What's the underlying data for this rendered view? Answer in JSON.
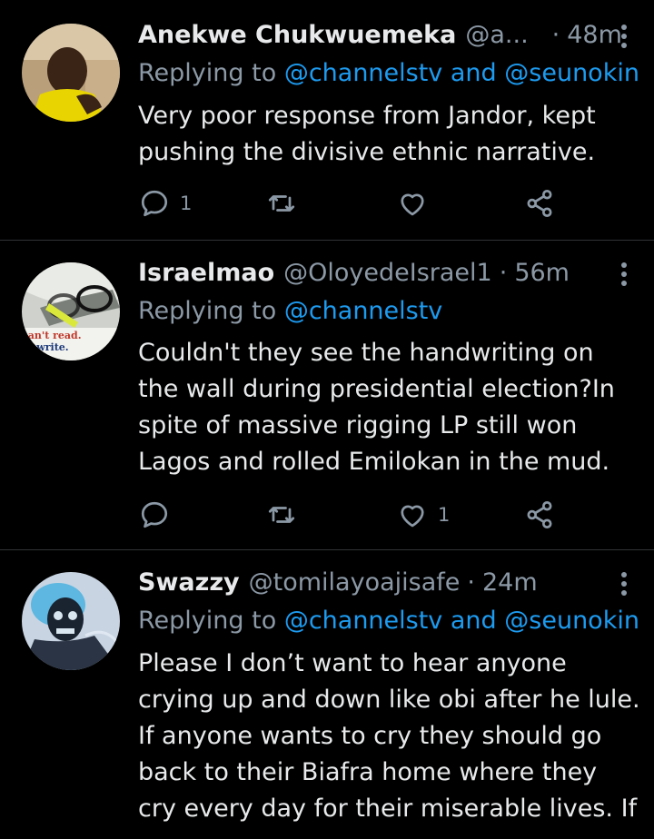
{
  "tweets": [
    {
      "name": "Anekwe Chukwuemeka",
      "handle": "@a...",
      "separator": "·",
      "time": "48m",
      "replying_label": "Replying to",
      "mention1": "@channelstv",
      "conj": "and",
      "mention2": "@seunokin",
      "text_lines": [
        "Very poor response from Jandor, kept",
        "pushing the divisive ethnic narrative."
      ],
      "reply_count": "1",
      "retweet_count": "",
      "like_count": ""
    },
    {
      "name": "Israelmao",
      "handle": "@OloyedeIsrael1",
      "separator": "·",
      "time": "56m",
      "replying_label": "Replying to",
      "mention1": "@channelstv",
      "text_lines": [
        "Couldn't they see the handwriting on",
        "the wall during presidential election?In",
        "spite of massive rigging LP still won",
        "Lagos and rolled Emilokan in the mud."
      ],
      "avatar_text": [
        "can't read.",
        "'t write."
      ],
      "reply_count": "",
      "retweet_count": "",
      "like_count": "1"
    },
    {
      "name": "Swazzy",
      "handle": "@tomilayoajisafe",
      "separator": "·",
      "time": "24m",
      "replying_label": "Replying to",
      "mention1": "@channelstv",
      "conj": "and",
      "mention2": "@seunokin",
      "text_lines": [
        "Please I don’t want to hear anyone",
        "crying up and down like obi after he lule.",
        "If anyone wants to cry they should go",
        "back to their Biafra home where they",
        "cry every day for their miserable lives. If"
      ]
    }
  ],
  "colors": {
    "background": "#000000",
    "text": "#e7e9ea",
    "muted": "#8b98a5",
    "link": "#1d9bf0",
    "divider": "#2f3336"
  },
  "icons": [
    "reply-icon",
    "retweet-icon",
    "like-icon",
    "share-icon",
    "more-options-icon"
  ]
}
